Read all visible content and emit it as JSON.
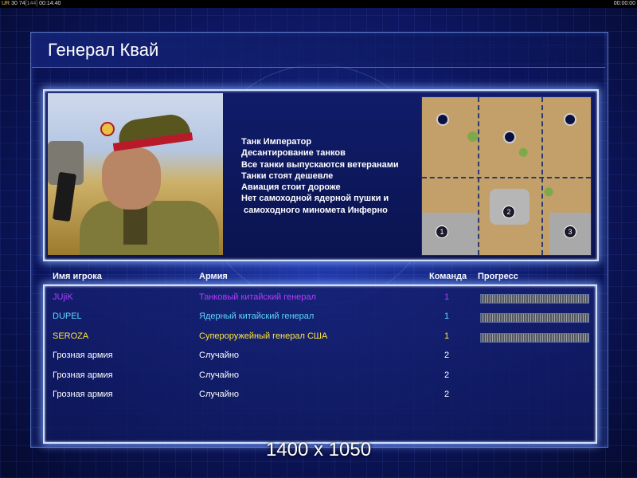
{
  "topbar": {
    "stats_prefix": "UR",
    "stats_a": "30",
    "stats_b": "74",
    "stats_bracket": "[144]",
    "time_left": "00:14:40",
    "time_right": "00:00:00"
  },
  "general": {
    "title": "Генерал Квай",
    "traits": [
      "Танк Император",
      "Десантирование танков",
      "Все танки выпускаются ветеранами",
      "Танки стоят дешевле",
      "Авиация стоит дороже",
      "Нет самоходной ядерной пушки и",
      " самоходного миномета Инферно"
    ]
  },
  "minimap": {
    "player_markers": [
      "1",
      "2",
      "3"
    ]
  },
  "players_table": {
    "columns": {
      "name": "Имя игрока",
      "army": "Армия",
      "team": "Команда",
      "progress": "Прогресс"
    },
    "rows": [
      {
        "name": "JUjiK",
        "army": "Танковый китайский генерал",
        "team": "1",
        "color": "#b43cff",
        "progress": 1.0
      },
      {
        "name": "DUPEL",
        "army": "Ядерный китайский генерал",
        "team": "1",
        "color": "#5fd7ff",
        "progress": 1.0
      },
      {
        "name": "SEROZA",
        "army": "Супероружейный генерал США",
        "team": "1",
        "color": "#ffe838",
        "progress": 1.0
      },
      {
        "name": "Грозная армия",
        "army": "Случайно",
        "team": "2",
        "color": "#ffffff"
      },
      {
        "name": "Грозная армия",
        "army": "Случайно",
        "team": "2",
        "color": "#ffffff"
      },
      {
        "name": "Грозная армия",
        "army": "Случайно",
        "team": "2",
        "color": "#ffffff"
      }
    ]
  },
  "resolution_label": "1400 x 1050"
}
